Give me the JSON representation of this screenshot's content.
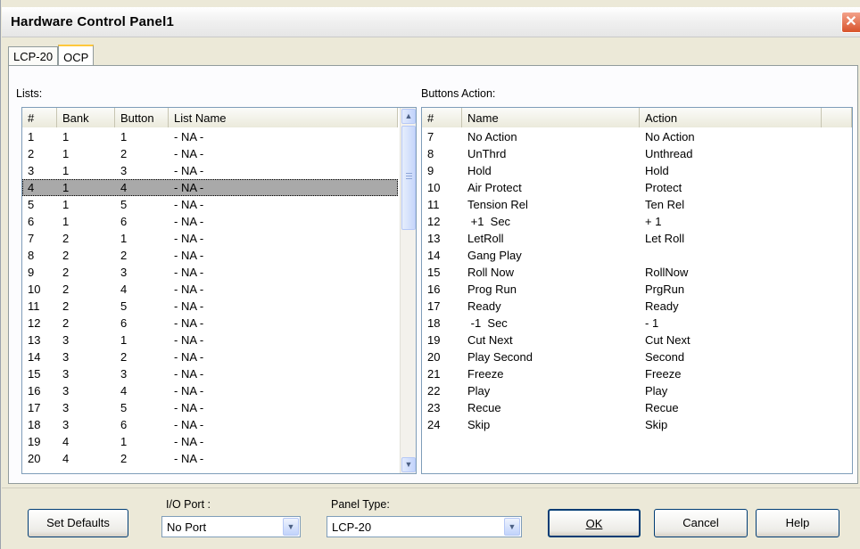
{
  "window": {
    "title": "Hardware Control Panel1",
    "close_glyph": "✕"
  },
  "tabs": [
    {
      "label": "LCP-20",
      "active": false
    },
    {
      "label": "OCP",
      "active": true
    }
  ],
  "lists": {
    "label": "Lists:",
    "columns": [
      "#",
      "Bank",
      "Button",
      "List Name"
    ],
    "rows": [
      [
        "1",
        "1",
        "1",
        "- NA -"
      ],
      [
        "2",
        "1",
        "2",
        "- NA -"
      ],
      [
        "3",
        "1",
        "3",
        "- NA -"
      ],
      [
        "4",
        "1",
        "4",
        "- NA -"
      ],
      [
        "5",
        "1",
        "5",
        "- NA -"
      ],
      [
        "6",
        "1",
        "6",
        "- NA -"
      ],
      [
        "7",
        "2",
        "1",
        "- NA -"
      ],
      [
        "8",
        "2",
        "2",
        "- NA -"
      ],
      [
        "9",
        "2",
        "3",
        "- NA -"
      ],
      [
        "10",
        "2",
        "4",
        "- NA -"
      ],
      [
        "11",
        "2",
        "5",
        "- NA -"
      ],
      [
        "12",
        "2",
        "6",
        "- NA -"
      ],
      [
        "13",
        "3",
        "1",
        "- NA -"
      ],
      [
        "14",
        "3",
        "2",
        "- NA -"
      ],
      [
        "15",
        "3",
        "3",
        "- NA -"
      ],
      [
        "16",
        "3",
        "4",
        "- NA -"
      ],
      [
        "17",
        "3",
        "5",
        "- NA -"
      ],
      [
        "18",
        "3",
        "6",
        "- NA -"
      ],
      [
        "19",
        "4",
        "1",
        "- NA -"
      ],
      [
        "20",
        "4",
        "2",
        "- NA -"
      ]
    ],
    "selected_row": "4"
  },
  "buttons_action": {
    "label": "Buttons Action:",
    "columns": [
      "#",
      "Name",
      "Action",
      ""
    ],
    "rows": [
      [
        "7",
        "No Action",
        "No Action"
      ],
      [
        "8",
        "UnThrd",
        "Unthread"
      ],
      [
        "9",
        "Hold",
        "Hold"
      ],
      [
        "10",
        "Air Protect",
        "Protect"
      ],
      [
        "11",
        "Tension Rel",
        "Ten Rel"
      ],
      [
        "12",
        " +1  Sec",
        "+ 1"
      ],
      [
        "13",
        "LetRoll",
        "Let Roll"
      ],
      [
        "14",
        "Gang Play",
        ""
      ],
      [
        "15",
        "Roll Now",
        "RollNow"
      ],
      [
        "16",
        "Prog Run",
        "PrgRun"
      ],
      [
        "17",
        "Ready",
        "Ready"
      ],
      [
        "18",
        " -1  Sec",
        "- 1"
      ],
      [
        "19",
        "Cut Next",
        "Cut Next"
      ],
      [
        "20",
        "Play Second",
        "Second"
      ],
      [
        "21",
        "Freeze",
        "Freeze"
      ],
      [
        "22",
        "Play",
        "Play"
      ],
      [
        "23",
        "Recue",
        "Recue"
      ],
      [
        "24",
        "Skip",
        "Skip"
      ]
    ]
  },
  "bottom": {
    "set_defaults": "Set Defaults",
    "io_port_label": "I/O Port :",
    "io_port_value": "No Port",
    "panel_type_label": "Panel Type:",
    "panel_type_value": "LCP-20",
    "ok_label": "OK",
    "cancel_label": "Cancel",
    "help_label": "Help"
  },
  "icons": {
    "scroll_up": "▲",
    "scroll_down": "▼",
    "dropdown": "▼"
  }
}
